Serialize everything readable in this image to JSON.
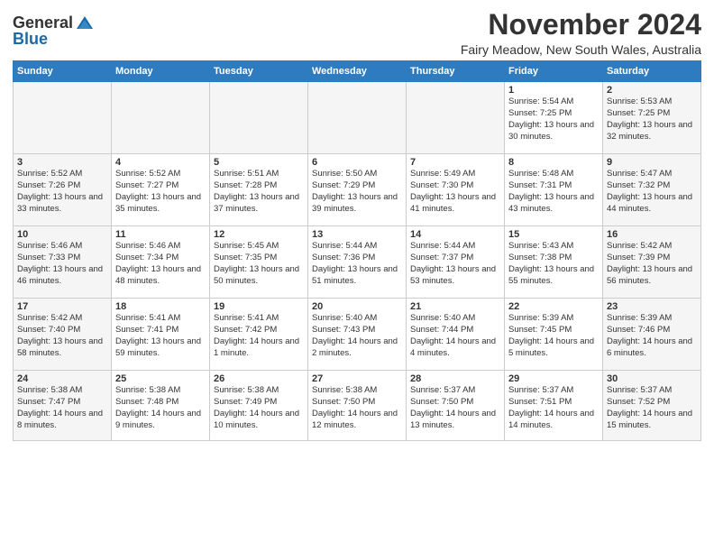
{
  "header": {
    "logo_general": "General",
    "logo_blue": "Blue",
    "month_title": "November 2024",
    "location": "Fairy Meadow, New South Wales, Australia"
  },
  "days_of_week": [
    "Sunday",
    "Monday",
    "Tuesday",
    "Wednesday",
    "Thursday",
    "Friday",
    "Saturday"
  ],
  "weeks": [
    [
      {
        "day": "",
        "info": ""
      },
      {
        "day": "",
        "info": ""
      },
      {
        "day": "",
        "info": ""
      },
      {
        "day": "",
        "info": ""
      },
      {
        "day": "",
        "info": ""
      },
      {
        "day": "1",
        "info": "Sunrise: 5:54 AM\nSunset: 7:25 PM\nDaylight: 13 hours and 30 minutes."
      },
      {
        "day": "2",
        "info": "Sunrise: 5:53 AM\nSunset: 7:25 PM\nDaylight: 13 hours and 32 minutes."
      }
    ],
    [
      {
        "day": "3",
        "info": "Sunrise: 5:52 AM\nSunset: 7:26 PM\nDaylight: 13 hours and 33 minutes."
      },
      {
        "day": "4",
        "info": "Sunrise: 5:52 AM\nSunset: 7:27 PM\nDaylight: 13 hours and 35 minutes."
      },
      {
        "day": "5",
        "info": "Sunrise: 5:51 AM\nSunset: 7:28 PM\nDaylight: 13 hours and 37 minutes."
      },
      {
        "day": "6",
        "info": "Sunrise: 5:50 AM\nSunset: 7:29 PM\nDaylight: 13 hours and 39 minutes."
      },
      {
        "day": "7",
        "info": "Sunrise: 5:49 AM\nSunset: 7:30 PM\nDaylight: 13 hours and 41 minutes."
      },
      {
        "day": "8",
        "info": "Sunrise: 5:48 AM\nSunset: 7:31 PM\nDaylight: 13 hours and 43 minutes."
      },
      {
        "day": "9",
        "info": "Sunrise: 5:47 AM\nSunset: 7:32 PM\nDaylight: 13 hours and 44 minutes."
      }
    ],
    [
      {
        "day": "10",
        "info": "Sunrise: 5:46 AM\nSunset: 7:33 PM\nDaylight: 13 hours and 46 minutes."
      },
      {
        "day": "11",
        "info": "Sunrise: 5:46 AM\nSunset: 7:34 PM\nDaylight: 13 hours and 48 minutes."
      },
      {
        "day": "12",
        "info": "Sunrise: 5:45 AM\nSunset: 7:35 PM\nDaylight: 13 hours and 50 minutes."
      },
      {
        "day": "13",
        "info": "Sunrise: 5:44 AM\nSunset: 7:36 PM\nDaylight: 13 hours and 51 minutes."
      },
      {
        "day": "14",
        "info": "Sunrise: 5:44 AM\nSunset: 7:37 PM\nDaylight: 13 hours and 53 minutes."
      },
      {
        "day": "15",
        "info": "Sunrise: 5:43 AM\nSunset: 7:38 PM\nDaylight: 13 hours and 55 minutes."
      },
      {
        "day": "16",
        "info": "Sunrise: 5:42 AM\nSunset: 7:39 PM\nDaylight: 13 hours and 56 minutes."
      }
    ],
    [
      {
        "day": "17",
        "info": "Sunrise: 5:42 AM\nSunset: 7:40 PM\nDaylight: 13 hours and 58 minutes."
      },
      {
        "day": "18",
        "info": "Sunrise: 5:41 AM\nSunset: 7:41 PM\nDaylight: 13 hours and 59 minutes."
      },
      {
        "day": "19",
        "info": "Sunrise: 5:41 AM\nSunset: 7:42 PM\nDaylight: 14 hours and 1 minute."
      },
      {
        "day": "20",
        "info": "Sunrise: 5:40 AM\nSunset: 7:43 PM\nDaylight: 14 hours and 2 minutes."
      },
      {
        "day": "21",
        "info": "Sunrise: 5:40 AM\nSunset: 7:44 PM\nDaylight: 14 hours and 4 minutes."
      },
      {
        "day": "22",
        "info": "Sunrise: 5:39 AM\nSunset: 7:45 PM\nDaylight: 14 hours and 5 minutes."
      },
      {
        "day": "23",
        "info": "Sunrise: 5:39 AM\nSunset: 7:46 PM\nDaylight: 14 hours and 6 minutes."
      }
    ],
    [
      {
        "day": "24",
        "info": "Sunrise: 5:38 AM\nSunset: 7:47 PM\nDaylight: 14 hours and 8 minutes."
      },
      {
        "day": "25",
        "info": "Sunrise: 5:38 AM\nSunset: 7:48 PM\nDaylight: 14 hours and 9 minutes."
      },
      {
        "day": "26",
        "info": "Sunrise: 5:38 AM\nSunset: 7:49 PM\nDaylight: 14 hours and 10 minutes."
      },
      {
        "day": "27",
        "info": "Sunrise: 5:38 AM\nSunset: 7:50 PM\nDaylight: 14 hours and 12 minutes."
      },
      {
        "day": "28",
        "info": "Sunrise: 5:37 AM\nSunset: 7:50 PM\nDaylight: 14 hours and 13 minutes."
      },
      {
        "day": "29",
        "info": "Sunrise: 5:37 AM\nSunset: 7:51 PM\nDaylight: 14 hours and 14 minutes."
      },
      {
        "day": "30",
        "info": "Sunrise: 5:37 AM\nSunset: 7:52 PM\nDaylight: 14 hours and 15 minutes."
      }
    ]
  ]
}
